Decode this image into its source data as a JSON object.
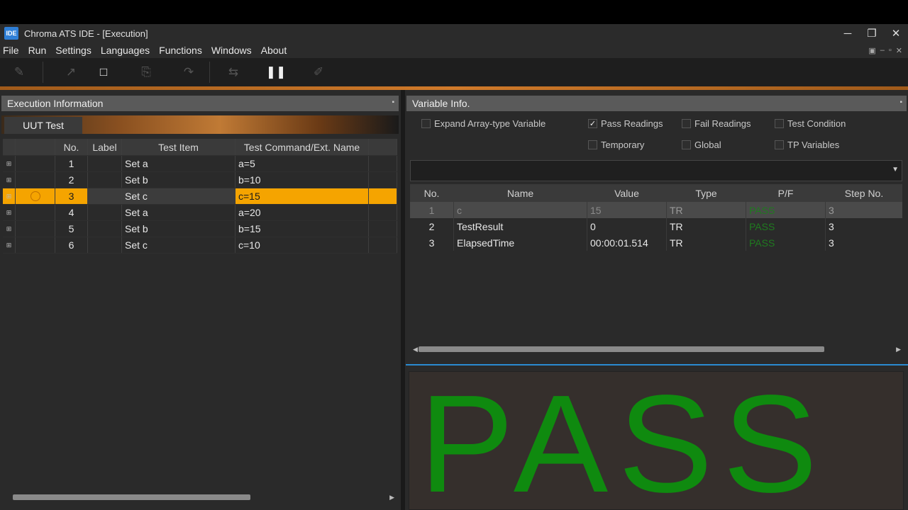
{
  "window": {
    "icon_label": "IDE",
    "title": "Chroma ATS IDE - [Execution]",
    "controls": [
      "─",
      "❐",
      "✕"
    ]
  },
  "menu": [
    "File",
    "Run",
    "Settings",
    "Languages",
    "Functions",
    "Windows",
    "About"
  ],
  "left_panel": {
    "header": "Execution Information",
    "tab": "UUT Test",
    "columns": [
      "No.",
      "Label",
      "Test Item",
      "Test Command/Ext. Name"
    ],
    "rows": [
      {
        "no": "1",
        "label": "",
        "item": "Set a",
        "cmd": "a=5"
      },
      {
        "no": "2",
        "label": "",
        "item": "Set b",
        "cmd": "b=10"
      },
      {
        "no": "3",
        "label": "",
        "item": "Set c",
        "cmd": "c=15"
      },
      {
        "no": "4",
        "label": "",
        "item": "Set a",
        "cmd": "a=20"
      },
      {
        "no": "5",
        "label": "",
        "item": "Set b",
        "cmd": "b=15"
      },
      {
        "no": "6",
        "label": "",
        "item": "Set c",
        "cmd": "c=10"
      }
    ],
    "selected_row": 3
  },
  "right_panel": {
    "header": "Variable Info.",
    "checkboxes": {
      "expand": {
        "label": "Expand Array-type Variable",
        "checked": false
      },
      "pass": {
        "label": "Pass Readings",
        "checked": true
      },
      "fail": {
        "label": "Fail Readings",
        "checked": false
      },
      "cond": {
        "label": "Test Condition",
        "checked": false
      },
      "temp": {
        "label": "Temporary",
        "checked": false
      },
      "global": {
        "label": "Global",
        "checked": false
      },
      "tp": {
        "label": "TP Variables",
        "checked": false
      }
    },
    "columns": [
      "No.",
      "Name",
      "Value",
      "Type",
      "P/F",
      "Step No."
    ],
    "rows": [
      {
        "no": "1",
        "name": "c",
        "value": "15",
        "type": "TR",
        "pf": "PASS",
        "step": "3"
      },
      {
        "no": "2",
        "name": "TestResult",
        "value": "0",
        "type": "TR",
        "pf": "PASS",
        "step": "3"
      },
      {
        "no": "3",
        "name": "ElapsedTime",
        "value": "00:00:01.514",
        "type": "TR",
        "pf": "PASS",
        "step": "3"
      }
    ]
  },
  "result": {
    "text": "PASS",
    "color": "#0f8a0f"
  }
}
